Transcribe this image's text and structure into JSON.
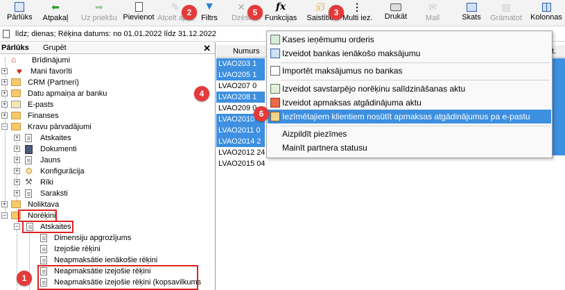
{
  "toolbar": {
    "items": [
      {
        "label": "Pārlūks",
        "icon": "browser-icon",
        "disabled": false
      },
      {
        "label": "Atpakaļ",
        "icon": "back-arrow-icon",
        "disabled": false
      },
      {
        "label": "Uz priekšu",
        "icon": "forward-arrow-icon",
        "disabled": true
      },
      {
        "label": "Pievienot",
        "icon": "new-document-icon",
        "disabled": false
      },
      {
        "label": "Atcelt apst.",
        "icon": "cancel-approval-icon",
        "disabled": true
      },
      {
        "label": "Filtrs",
        "icon": "filter-icon",
        "disabled": false
      },
      {
        "label": "Dzēst",
        "icon": "delete-icon",
        "disabled": true
      },
      {
        "label": "Funkcijas",
        "icon": "functions-icon",
        "disabled": false
      },
      {
        "label": "Saistītie",
        "icon": "related-icon",
        "disabled": false
      },
      {
        "label": "Multi iez.",
        "icon": "more-vertical-icon",
        "disabled": false
      },
      {
        "label": "Drukāt",
        "icon": "printer-icon",
        "disabled": false
      },
      {
        "label": "Mail",
        "icon": "mail-icon",
        "disabled": true
      },
      {
        "label": "Skats",
        "icon": "view-icon",
        "disabled": false
      },
      {
        "label": "Grāmatot",
        "icon": "book-icon",
        "disabled": true
      },
      {
        "label": "Kolonnas",
        "icon": "columns-icon",
        "disabled": false
      }
    ]
  },
  "infobar": {
    "text": "līdz; dienas; Rēķina datums: no 01.01.2022 līdz 31.12.2022"
  },
  "panel": {
    "tab_browser": "Pārlūks",
    "tab_group": "Grupēt",
    "close": "✕"
  },
  "tree": [
    {
      "label": "Brīdinājumi"
    },
    {
      "label": "Mani favorīti"
    },
    {
      "label": "CRM (Partneri)"
    },
    {
      "label": "Datu apmaiņa ar banku"
    },
    {
      "label": "E-pasts"
    },
    {
      "label": "Finanses"
    },
    {
      "label": "Kravu pārvadājumi"
    },
    {
      "label": "Atskaites"
    },
    {
      "label": "Dokumenti"
    },
    {
      "label": "Jauns"
    },
    {
      "label": "Konfigurācija"
    },
    {
      "label": "Rīki"
    },
    {
      "label": "Saraksti"
    },
    {
      "label": "Noliktava"
    },
    {
      "label": "Norēķini"
    },
    {
      "label": "Atskaites"
    },
    {
      "label": "Dimensiju apgrozījums"
    },
    {
      "label": "Izejošie rēķini"
    },
    {
      "label": "Neapmaksātie ienākošie rēķini"
    },
    {
      "label": "Neapmaksātie izejošie rēķini"
    },
    {
      "label": "Neapmaksātie izejošie rēķini (kopsavilkums"
    }
  ],
  "grid": {
    "col_numurs": "Numurs",
    "col_right": "at.",
    "rows": [
      {
        "num": "LVAO203",
        "extra": "1",
        "selected": true
      },
      {
        "num": "LVAO205",
        "extra": "1",
        "selected": true
      },
      {
        "num": "LVAO207",
        "extra": "0",
        "selected": false
      },
      {
        "num": "LVAO208",
        "extra": "1",
        "selected": true
      },
      {
        "num": "LVAO209",
        "extra": "0",
        "selected": false
      },
      {
        "num": "LVAO2010",
        "extra": "",
        "selected": true
      },
      {
        "num": "LVAO2011",
        "extra": "0",
        "selected": true
      },
      {
        "num": "LVAO2014",
        "extra": "2",
        "selected": true
      },
      {
        "num": "LVAO2012",
        "extra": "24",
        "selected": false
      },
      {
        "num": "LVAO2015",
        "extra": "04",
        "selected": false
      }
    ]
  },
  "menu": {
    "items": [
      {
        "label": "Kases ieņēmumu orderis",
        "icon": "cash-order-icon"
      },
      {
        "label": "Izveidot bankas ienākošo maksājumu",
        "icon": "bank-payment-icon"
      },
      {
        "label": "Importēt maksājumus no bankas",
        "icon": "import-icon"
      },
      {
        "label": "Izveidot savstarpējo norēķinu salīdzināšanas aktu",
        "icon": "reconciliation-icon"
      },
      {
        "label": "Izveidot apmaksas atgādinājuma aktu",
        "icon": "reminder-document-icon"
      },
      {
        "label": "Iezīmētajiem klientiem nosūtīt apmaksas atgādinājumus pa e-pastu",
        "icon": "email-reminder-icon"
      },
      {
        "label": "Aizpildīt piezīmes",
        "icon": ""
      },
      {
        "label": "Mainīt partnera statusu",
        "icon": ""
      }
    ]
  },
  "badges": [
    "1",
    "2",
    "3",
    "4",
    "5",
    "6"
  ],
  "colors": {
    "selection": "#3d8fe0",
    "highlight": "#e02020",
    "badge": "#e53a3a"
  }
}
